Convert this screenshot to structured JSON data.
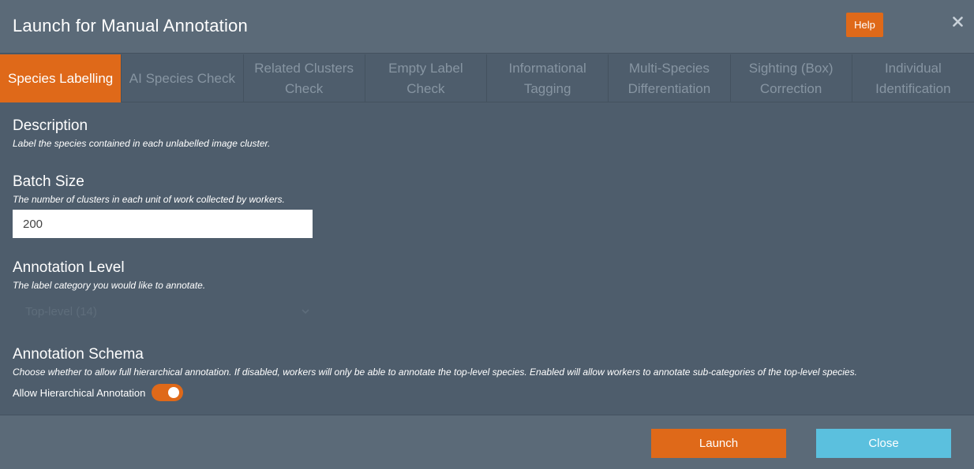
{
  "header": {
    "title": "Launch for Manual Annotation",
    "help_label": "Help",
    "close_glyph": "×"
  },
  "tabs": [
    {
      "label": "Species Labelling",
      "active": true
    },
    {
      "label": "AI Species Check",
      "active": false
    },
    {
      "label": "Related Clusters\nCheck",
      "active": false
    },
    {
      "label": "Empty Label Check",
      "active": false
    },
    {
      "label": "Informational\nTagging",
      "active": false
    },
    {
      "label": "Multi-Species\nDifferentiation",
      "active": false
    },
    {
      "label": "Sighting (Box)\nCorrection",
      "active": false
    },
    {
      "label": "Individual\nIdentification",
      "active": false
    }
  ],
  "description": {
    "title": "Description",
    "text": "Label the species contained in each unlabelled image cluster."
  },
  "batch_size": {
    "title": "Batch Size",
    "text": "The number of clusters in each unit of work collected by workers.",
    "value": "200"
  },
  "annotation_level": {
    "title": "Annotation Level",
    "text": "The label category you would like to annotate.",
    "selected": "Top-level (14)"
  },
  "annotation_schema": {
    "title": "Annotation Schema",
    "text": "Choose whether to allow full hierarchical annotation. If disabled, workers will only be able to annotate the top-level species. Enabled will allow workers to annotate sub-categories of the top-level species.",
    "toggle_label": "Allow Hierarchical Annotation",
    "toggle_on": true
  },
  "footer": {
    "launch_label": "Launch",
    "close_label": "Close"
  },
  "colors": {
    "accent": "#df6919",
    "info": "#5bc0de",
    "panel": "#4e5d6c",
    "header": "#5b6a78"
  },
  "icons": {
    "close": "close-icon",
    "chevron": "chevron-down-icon"
  }
}
